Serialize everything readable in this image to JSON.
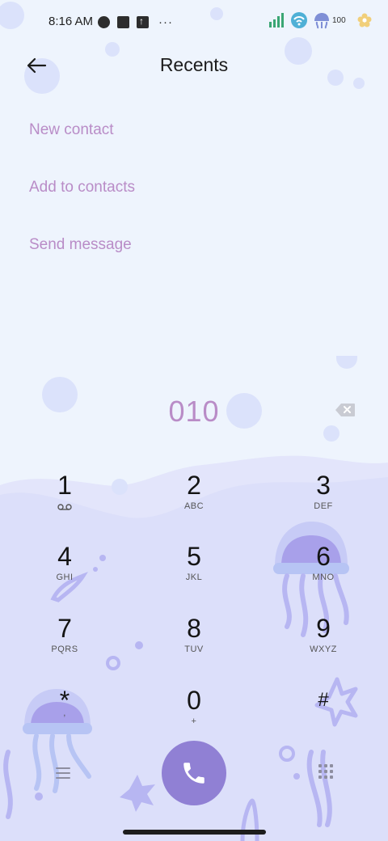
{
  "status_bar": {
    "time": "8:16 AM",
    "dots": "···",
    "battery": "100",
    "icons_left": [
      "circle-status-icon",
      "square-status-icon",
      "upload-status-icon"
    ],
    "icons_right": [
      "signal-icon",
      "wifi-icon",
      "battery-icon",
      "flower-icon"
    ]
  },
  "header": {
    "title": "Recents",
    "back_icon": "back-arrow-icon"
  },
  "menu": {
    "items": [
      "New contact",
      "Add to contacts",
      "Send message"
    ]
  },
  "dialer": {
    "number": "010",
    "backspace_icon": "backspace-icon",
    "keys": [
      {
        "digit": "1",
        "letters": "voicemail"
      },
      {
        "digit": "2",
        "letters": "ABC"
      },
      {
        "digit": "3",
        "letters": "DEF"
      },
      {
        "digit": "4",
        "letters": "GHI"
      },
      {
        "digit": "5",
        "letters": "JKL"
      },
      {
        "digit": "6",
        "letters": "MNO"
      },
      {
        "digit": "7",
        "letters": "PQRS"
      },
      {
        "digit": "8",
        "letters": "TUV"
      },
      {
        "digit": "9",
        "letters": "WXYZ"
      },
      {
        "digit": "*",
        "letters": ","
      },
      {
        "digit": "0",
        "letters": "+"
      },
      {
        "digit": "#",
        "letters": ""
      }
    ],
    "call_icon": "phone-icon",
    "menu_icon": "menu-icon",
    "keypad_icon": "keypad-icon"
  },
  "colors": {
    "background": "#eef4fd",
    "accent": "#b98cc7",
    "call_button": "#9080d4",
    "sea": "#dfe2fb"
  }
}
